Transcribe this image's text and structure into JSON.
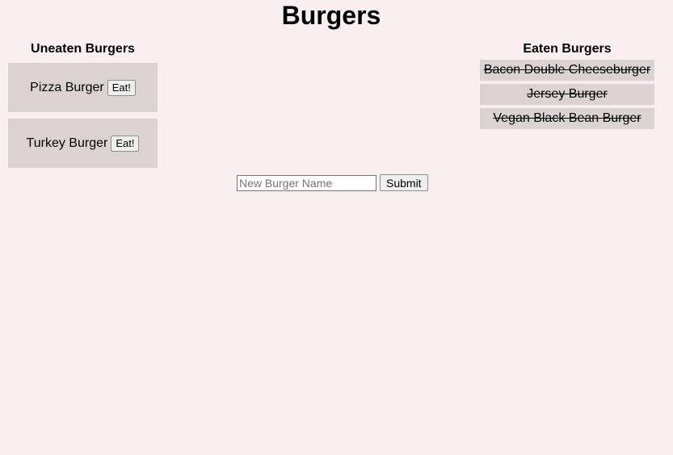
{
  "page": {
    "title": "Burgers"
  },
  "uneaten": {
    "heading": "Uneaten Burgers",
    "items": [
      {
        "name": "Pizza Burger",
        "button": "Eat!"
      },
      {
        "name": "Turkey Burger",
        "button": "Eat!"
      }
    ]
  },
  "eaten": {
    "heading": "Eaten Burgers",
    "items": [
      {
        "name": "Bacon Double Cheeseburger"
      },
      {
        "name": "Jersey Burger"
      },
      {
        "name": "Vegan Black Bean Burger"
      }
    ]
  },
  "form": {
    "placeholder": "New Burger Name",
    "value": "",
    "submit_label": "Submit"
  },
  "colors": {
    "background": "#f9eff0",
    "card": "#dbd2d3"
  }
}
